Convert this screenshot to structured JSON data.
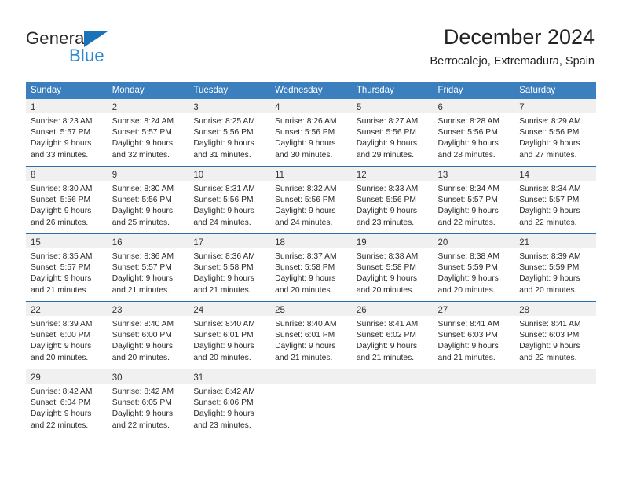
{
  "brand": {
    "name_top": "General",
    "name_bottom": "Blue",
    "triangle_color": "#1a73b8",
    "blue_text_color": "#2b86d4"
  },
  "header": {
    "title": "December 2024",
    "subtitle": "Berrocalejo, Extremadura, Spain"
  },
  "theme": {
    "header_row_bg": "#3c7fbe",
    "row_separator": "#2f6ea8",
    "daynum_band_bg": "#f0f0f0"
  },
  "weekday_headers": [
    "Sunday",
    "Monday",
    "Tuesday",
    "Wednesday",
    "Thursday",
    "Friday",
    "Saturday"
  ],
  "weeks": [
    [
      {
        "day": "1",
        "sunrise": "Sunrise: 8:23 AM",
        "sunset": "Sunset: 5:57 PM",
        "daylight1": "Daylight: 9 hours",
        "daylight2": "and 33 minutes."
      },
      {
        "day": "2",
        "sunrise": "Sunrise: 8:24 AM",
        "sunset": "Sunset: 5:57 PM",
        "daylight1": "Daylight: 9 hours",
        "daylight2": "and 32 minutes."
      },
      {
        "day": "3",
        "sunrise": "Sunrise: 8:25 AM",
        "sunset": "Sunset: 5:56 PM",
        "daylight1": "Daylight: 9 hours",
        "daylight2": "and 31 minutes."
      },
      {
        "day": "4",
        "sunrise": "Sunrise: 8:26 AM",
        "sunset": "Sunset: 5:56 PM",
        "daylight1": "Daylight: 9 hours",
        "daylight2": "and 30 minutes."
      },
      {
        "day": "5",
        "sunrise": "Sunrise: 8:27 AM",
        "sunset": "Sunset: 5:56 PM",
        "daylight1": "Daylight: 9 hours",
        "daylight2": "and 29 minutes."
      },
      {
        "day": "6",
        "sunrise": "Sunrise: 8:28 AM",
        "sunset": "Sunset: 5:56 PM",
        "daylight1": "Daylight: 9 hours",
        "daylight2": "and 28 minutes."
      },
      {
        "day": "7",
        "sunrise": "Sunrise: 8:29 AM",
        "sunset": "Sunset: 5:56 PM",
        "daylight1": "Daylight: 9 hours",
        "daylight2": "and 27 minutes."
      }
    ],
    [
      {
        "day": "8",
        "sunrise": "Sunrise: 8:30 AM",
        "sunset": "Sunset: 5:56 PM",
        "daylight1": "Daylight: 9 hours",
        "daylight2": "and 26 minutes."
      },
      {
        "day": "9",
        "sunrise": "Sunrise: 8:30 AM",
        "sunset": "Sunset: 5:56 PM",
        "daylight1": "Daylight: 9 hours",
        "daylight2": "and 25 minutes."
      },
      {
        "day": "10",
        "sunrise": "Sunrise: 8:31 AM",
        "sunset": "Sunset: 5:56 PM",
        "daylight1": "Daylight: 9 hours",
        "daylight2": "and 24 minutes."
      },
      {
        "day": "11",
        "sunrise": "Sunrise: 8:32 AM",
        "sunset": "Sunset: 5:56 PM",
        "daylight1": "Daylight: 9 hours",
        "daylight2": "and 24 minutes."
      },
      {
        "day": "12",
        "sunrise": "Sunrise: 8:33 AM",
        "sunset": "Sunset: 5:56 PM",
        "daylight1": "Daylight: 9 hours",
        "daylight2": "and 23 minutes."
      },
      {
        "day": "13",
        "sunrise": "Sunrise: 8:34 AM",
        "sunset": "Sunset: 5:57 PM",
        "daylight1": "Daylight: 9 hours",
        "daylight2": "and 22 minutes."
      },
      {
        "day": "14",
        "sunrise": "Sunrise: 8:34 AM",
        "sunset": "Sunset: 5:57 PM",
        "daylight1": "Daylight: 9 hours",
        "daylight2": "and 22 minutes."
      }
    ],
    [
      {
        "day": "15",
        "sunrise": "Sunrise: 8:35 AM",
        "sunset": "Sunset: 5:57 PM",
        "daylight1": "Daylight: 9 hours",
        "daylight2": "and 21 minutes."
      },
      {
        "day": "16",
        "sunrise": "Sunrise: 8:36 AM",
        "sunset": "Sunset: 5:57 PM",
        "daylight1": "Daylight: 9 hours",
        "daylight2": "and 21 minutes."
      },
      {
        "day": "17",
        "sunrise": "Sunrise: 8:36 AM",
        "sunset": "Sunset: 5:58 PM",
        "daylight1": "Daylight: 9 hours",
        "daylight2": "and 21 minutes."
      },
      {
        "day": "18",
        "sunrise": "Sunrise: 8:37 AM",
        "sunset": "Sunset: 5:58 PM",
        "daylight1": "Daylight: 9 hours",
        "daylight2": "and 20 minutes."
      },
      {
        "day": "19",
        "sunrise": "Sunrise: 8:38 AM",
        "sunset": "Sunset: 5:58 PM",
        "daylight1": "Daylight: 9 hours",
        "daylight2": "and 20 minutes."
      },
      {
        "day": "20",
        "sunrise": "Sunrise: 8:38 AM",
        "sunset": "Sunset: 5:59 PM",
        "daylight1": "Daylight: 9 hours",
        "daylight2": "and 20 minutes."
      },
      {
        "day": "21",
        "sunrise": "Sunrise: 8:39 AM",
        "sunset": "Sunset: 5:59 PM",
        "daylight1": "Daylight: 9 hours",
        "daylight2": "and 20 minutes."
      }
    ],
    [
      {
        "day": "22",
        "sunrise": "Sunrise: 8:39 AM",
        "sunset": "Sunset: 6:00 PM",
        "daylight1": "Daylight: 9 hours",
        "daylight2": "and 20 minutes."
      },
      {
        "day": "23",
        "sunrise": "Sunrise: 8:40 AM",
        "sunset": "Sunset: 6:00 PM",
        "daylight1": "Daylight: 9 hours",
        "daylight2": "and 20 minutes."
      },
      {
        "day": "24",
        "sunrise": "Sunrise: 8:40 AM",
        "sunset": "Sunset: 6:01 PM",
        "daylight1": "Daylight: 9 hours",
        "daylight2": "and 20 minutes."
      },
      {
        "day": "25",
        "sunrise": "Sunrise: 8:40 AM",
        "sunset": "Sunset: 6:01 PM",
        "daylight1": "Daylight: 9 hours",
        "daylight2": "and 21 minutes."
      },
      {
        "day": "26",
        "sunrise": "Sunrise: 8:41 AM",
        "sunset": "Sunset: 6:02 PM",
        "daylight1": "Daylight: 9 hours",
        "daylight2": "and 21 minutes."
      },
      {
        "day": "27",
        "sunrise": "Sunrise: 8:41 AM",
        "sunset": "Sunset: 6:03 PM",
        "daylight1": "Daylight: 9 hours",
        "daylight2": "and 21 minutes."
      },
      {
        "day": "28",
        "sunrise": "Sunrise: 8:41 AM",
        "sunset": "Sunset: 6:03 PM",
        "daylight1": "Daylight: 9 hours",
        "daylight2": "and 22 minutes."
      }
    ],
    [
      {
        "day": "29",
        "sunrise": "Sunrise: 8:42 AM",
        "sunset": "Sunset: 6:04 PM",
        "daylight1": "Daylight: 9 hours",
        "daylight2": "and 22 minutes."
      },
      {
        "day": "30",
        "sunrise": "Sunrise: 8:42 AM",
        "sunset": "Sunset: 6:05 PM",
        "daylight1": "Daylight: 9 hours",
        "daylight2": "and 22 minutes."
      },
      {
        "day": "31",
        "sunrise": "Sunrise: 8:42 AM",
        "sunset": "Sunset: 6:06 PM",
        "daylight1": "Daylight: 9 hours",
        "daylight2": "and 23 minutes."
      },
      {
        "day": "",
        "sunrise": "",
        "sunset": "",
        "daylight1": "",
        "daylight2": ""
      },
      {
        "day": "",
        "sunrise": "",
        "sunset": "",
        "daylight1": "",
        "daylight2": ""
      },
      {
        "day": "",
        "sunrise": "",
        "sunset": "",
        "daylight1": "",
        "daylight2": ""
      },
      {
        "day": "",
        "sunrise": "",
        "sunset": "",
        "daylight1": "",
        "daylight2": ""
      }
    ]
  ]
}
